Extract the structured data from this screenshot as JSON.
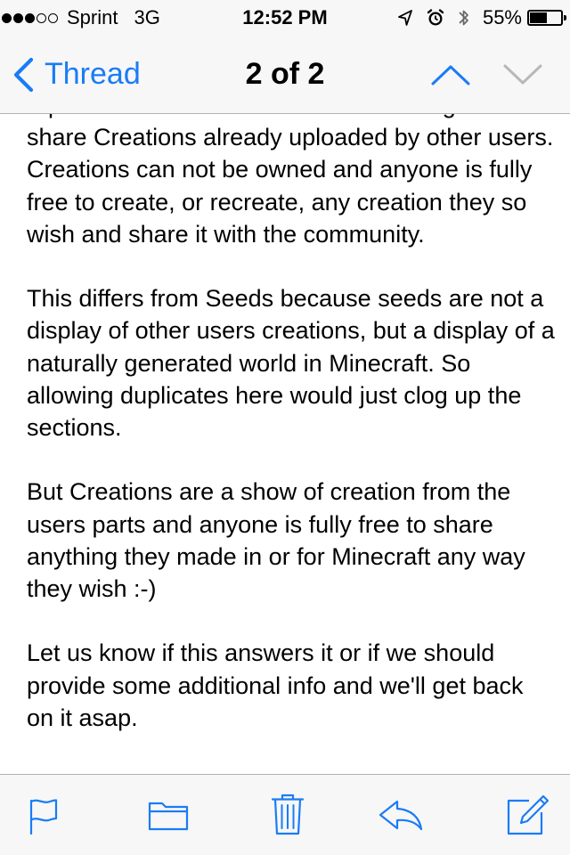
{
  "status_bar": {
    "signal_bars_filled": 3,
    "signal_bars_total": 5,
    "carrier": "Sprint",
    "network": "3G",
    "time": "12:52 PM",
    "icons": [
      "location-icon",
      "alarm-icon",
      "bluetooth-icon"
    ],
    "battery_percent_label": "55%",
    "battery_level": 0.55
  },
  "nav": {
    "back_label": "Thread",
    "title": "2 of 2",
    "up_enabled": true,
    "down_enabled": false
  },
  "message": {
    "paragraphs": [
      "A parallel could be drawn to not allowing users to share Creations already uploaded by other users. Creations can not be owned and anyone is fully free to create, or recreate, any creation they so wish and share it with the community.",
      "This differs from Seeds because seeds are not a display of other users creations, but a display of a naturally generated world in Minecraft. So allowing duplicates here would just clog up the sections.",
      "But Creations are a show of creation from the users parts and anyone is fully free to share anything they made in or for Minecraft any way they wish :-)",
      "Let us know if this answers it or if we should provide some additional info and we'll get back on it asap."
    ]
  },
  "toolbar": {
    "buttons": [
      "flag-icon",
      "folder-icon",
      "trash-icon",
      "reply-icon",
      "compose-icon"
    ]
  },
  "colors": {
    "accent": "#1a7cf5",
    "disabled": "#b8b8b8",
    "bar_background": "#f7f7f7",
    "content_background": "#ffffff"
  }
}
